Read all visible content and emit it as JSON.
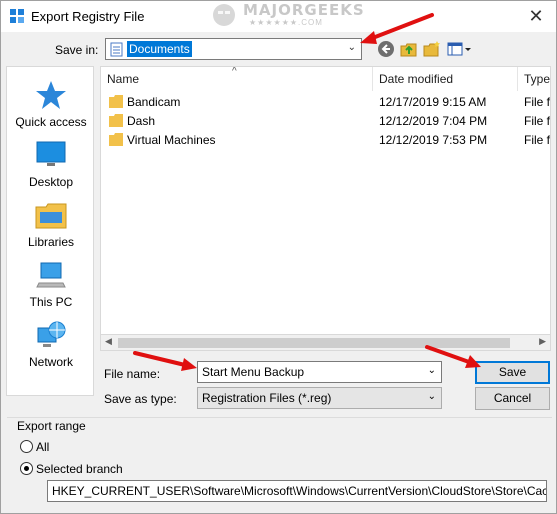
{
  "window": {
    "title": "Export Registry File",
    "watermark": "MAJORGEEKS",
    "watermark_sub": "★★★★★★.COM"
  },
  "save_in": {
    "label": "Save in:",
    "value": "Documents"
  },
  "places": [
    {
      "label": "Quick access",
      "icon": "star-icon"
    },
    {
      "label": "Desktop",
      "icon": "desktop-icon"
    },
    {
      "label": "Libraries",
      "icon": "libraries-icon"
    },
    {
      "label": "This PC",
      "icon": "computer-icon"
    },
    {
      "label": "Network",
      "icon": "network-icon"
    }
  ],
  "file_list": {
    "columns": [
      "Name",
      "Date modified",
      "Type"
    ],
    "rows": [
      {
        "name": "Bandicam",
        "date": "12/17/2019 9:15 AM",
        "type": "File fo"
      },
      {
        "name": "Dash",
        "date": "12/12/2019 7:04 PM",
        "type": "File fo"
      },
      {
        "name": "Virtual Machines",
        "date": "12/12/2019 7:53 PM",
        "type": "File fo"
      }
    ]
  },
  "file_name": {
    "label": "File name:",
    "value": "Start Menu Backup"
  },
  "file_type": {
    "label": "Save as type:",
    "value": "Registration Files (*.reg)"
  },
  "buttons": {
    "save": "Save",
    "cancel": "Cancel"
  },
  "export_range": {
    "title": "Export range",
    "all_label": "All",
    "selected_label": "Selected branch",
    "branch_path": "HKEY_CURRENT_USER\\Software\\Microsoft\\Windows\\CurrentVersion\\CloudStore\\Store\\Cache\\Def"
  },
  "colors": {
    "accent": "#0078d7",
    "annotation_arrow": "#e01010"
  }
}
